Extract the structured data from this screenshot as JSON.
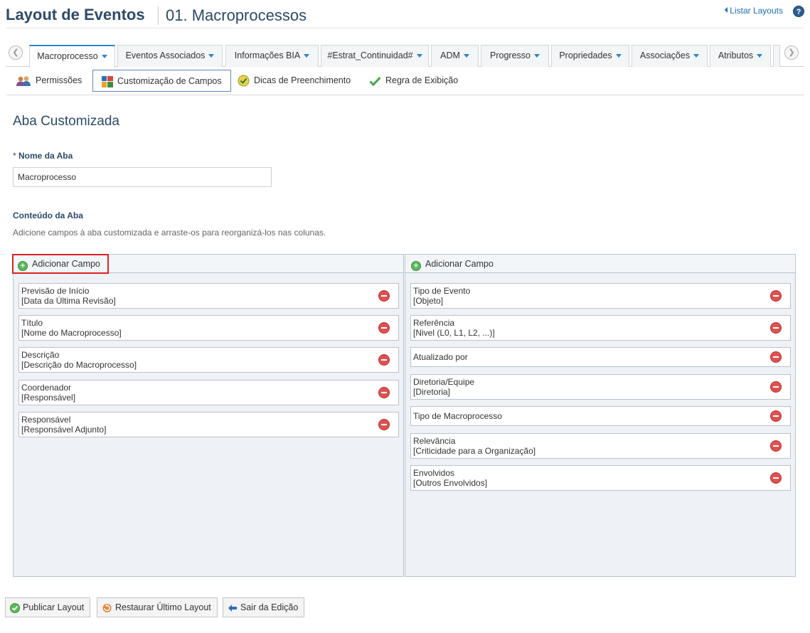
{
  "header": {
    "title": "Layout de Eventos",
    "subtitle": "01. Macroprocessos",
    "list_link": "Listar Layouts",
    "help": "?"
  },
  "tabs": [
    {
      "label": "Macroprocesso",
      "active": true
    },
    {
      "label": "Eventos Associados",
      "active": false
    },
    {
      "label": "Informações BIA",
      "active": false
    },
    {
      "label": "#Estrat_Continuidad#",
      "active": false
    },
    {
      "label": "ADM",
      "active": false
    },
    {
      "label": "Progresso",
      "active": false
    },
    {
      "label": "Propriedades",
      "active": false
    },
    {
      "label": "Associações",
      "active": false
    },
    {
      "label": "Atributos",
      "active": false
    }
  ],
  "subtoolbar": {
    "permissions": "Permissões",
    "customization": "Customização de Campos",
    "tips": "Dicas de Preenchimento",
    "rule": "Regra de Exibição"
  },
  "section": {
    "title": "Aba Customizada",
    "name_label": "Nome da Aba",
    "name_required": "*",
    "name_value": "Macroprocesso",
    "content_label": "Conteúdo da Aba",
    "content_desc": "Adicione campos à aba customizada e arraste-os para reorganizá-los nas colunas."
  },
  "columns": {
    "add_label": "Adicionar Campo",
    "left": [
      {
        "line1": "Previsão de Início",
        "line2": "[Data da Última Revisão]"
      },
      {
        "line1": "Título",
        "line2": "[Nome do Macroprocesso]"
      },
      {
        "line1": "Descrição",
        "line2": "[Descrição do Macroprocesso]"
      },
      {
        "line1": "Coordenador",
        "line2": "[Responsável]"
      },
      {
        "line1": "Responsável",
        "line2": "[Responsável Adjunto]"
      }
    ],
    "right": [
      {
        "line1": "Tipo de Evento",
        "line2": "[Objeto]"
      },
      {
        "line1": "Referência",
        "line2": "[Nivel (L0, L1, L2, ...)]"
      },
      {
        "line1": "Atualizado por",
        "line2": ""
      },
      {
        "line1": "Diretoria/Equipe",
        "line2": "[Diretoria]"
      },
      {
        "line1": "Tipo de Macroprocesso",
        "line2": ""
      },
      {
        "line1": "Relevância",
        "line2": "[Criticidade para a Organização]"
      },
      {
        "line1": "Envolvidos",
        "line2": "[Outros Envolvidos]"
      }
    ]
  },
  "footer": {
    "publish": "Publicar Layout",
    "restore": "Restaurar Último Layout",
    "exit": "Sair da Edição"
  }
}
